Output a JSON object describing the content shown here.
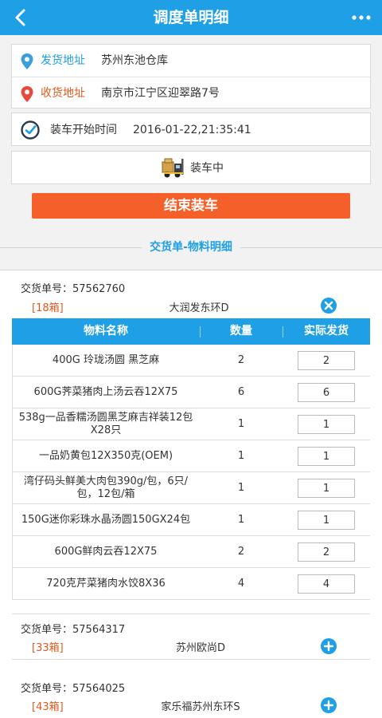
{
  "header": {
    "title": "调度单明细"
  },
  "shipment": {
    "from_label": "发货地址",
    "from_value": "苏州东池仓库",
    "to_label": "收货地址",
    "to_value": "南京市江宁区迎翠路7号",
    "start_label": "装车开始时间",
    "start_value": "2016-01-22,21:35:41",
    "status": "装车中"
  },
  "actions": {
    "end_loading": "结束装车"
  },
  "section": {
    "title": "交货单-物料明细"
  },
  "columns": {
    "name": "物料名称",
    "qty": "数量",
    "actual": "实际发货"
  },
  "orders": [
    {
      "number": "交货单号：57562760",
      "boxes": "[18箱]",
      "store": "大润发东环D",
      "expanded": true,
      "items": [
        {
          "name": "400G 玲珑汤圆 黑芝麻",
          "qty": "2",
          "actual": "2"
        },
        {
          "name": "600G荠菜猪肉上汤云吞12X75",
          "qty": "6",
          "actual": "6"
        },
        {
          "name": "538g一品香糯汤圆黑芝麻吉祥装12包X28只",
          "qty": "1",
          "actual": "1"
        },
        {
          "name": "一品奶黄包12X350克(OEM)",
          "qty": "1",
          "actual": "1"
        },
        {
          "name": "湾仔码头鲜美大肉包390g/包，6只/包，12包/箱",
          "qty": "1",
          "actual": "1"
        },
        {
          "name": "150G迷你彩珠水晶汤圆150GX24包",
          "qty": "1",
          "actual": "1"
        },
        {
          "name": "600G鲜肉云吞12X75",
          "qty": "2",
          "actual": "2"
        },
        {
          "name": "720克芹菜猪肉水饺8X36",
          "qty": "4",
          "actual": "4"
        }
      ]
    },
    {
      "number": "交货单号：57564317",
      "boxes": "[33箱]",
      "store": "苏州欧尚D",
      "expanded": false
    },
    {
      "number": "交货单号：57564025",
      "boxes": "[43箱]",
      "store": "家乐福苏州东环S",
      "expanded": false
    }
  ],
  "colors": {
    "primary": "#1e9fe6",
    "accent": "#f5602a",
    "box_count": "#e05a20"
  }
}
